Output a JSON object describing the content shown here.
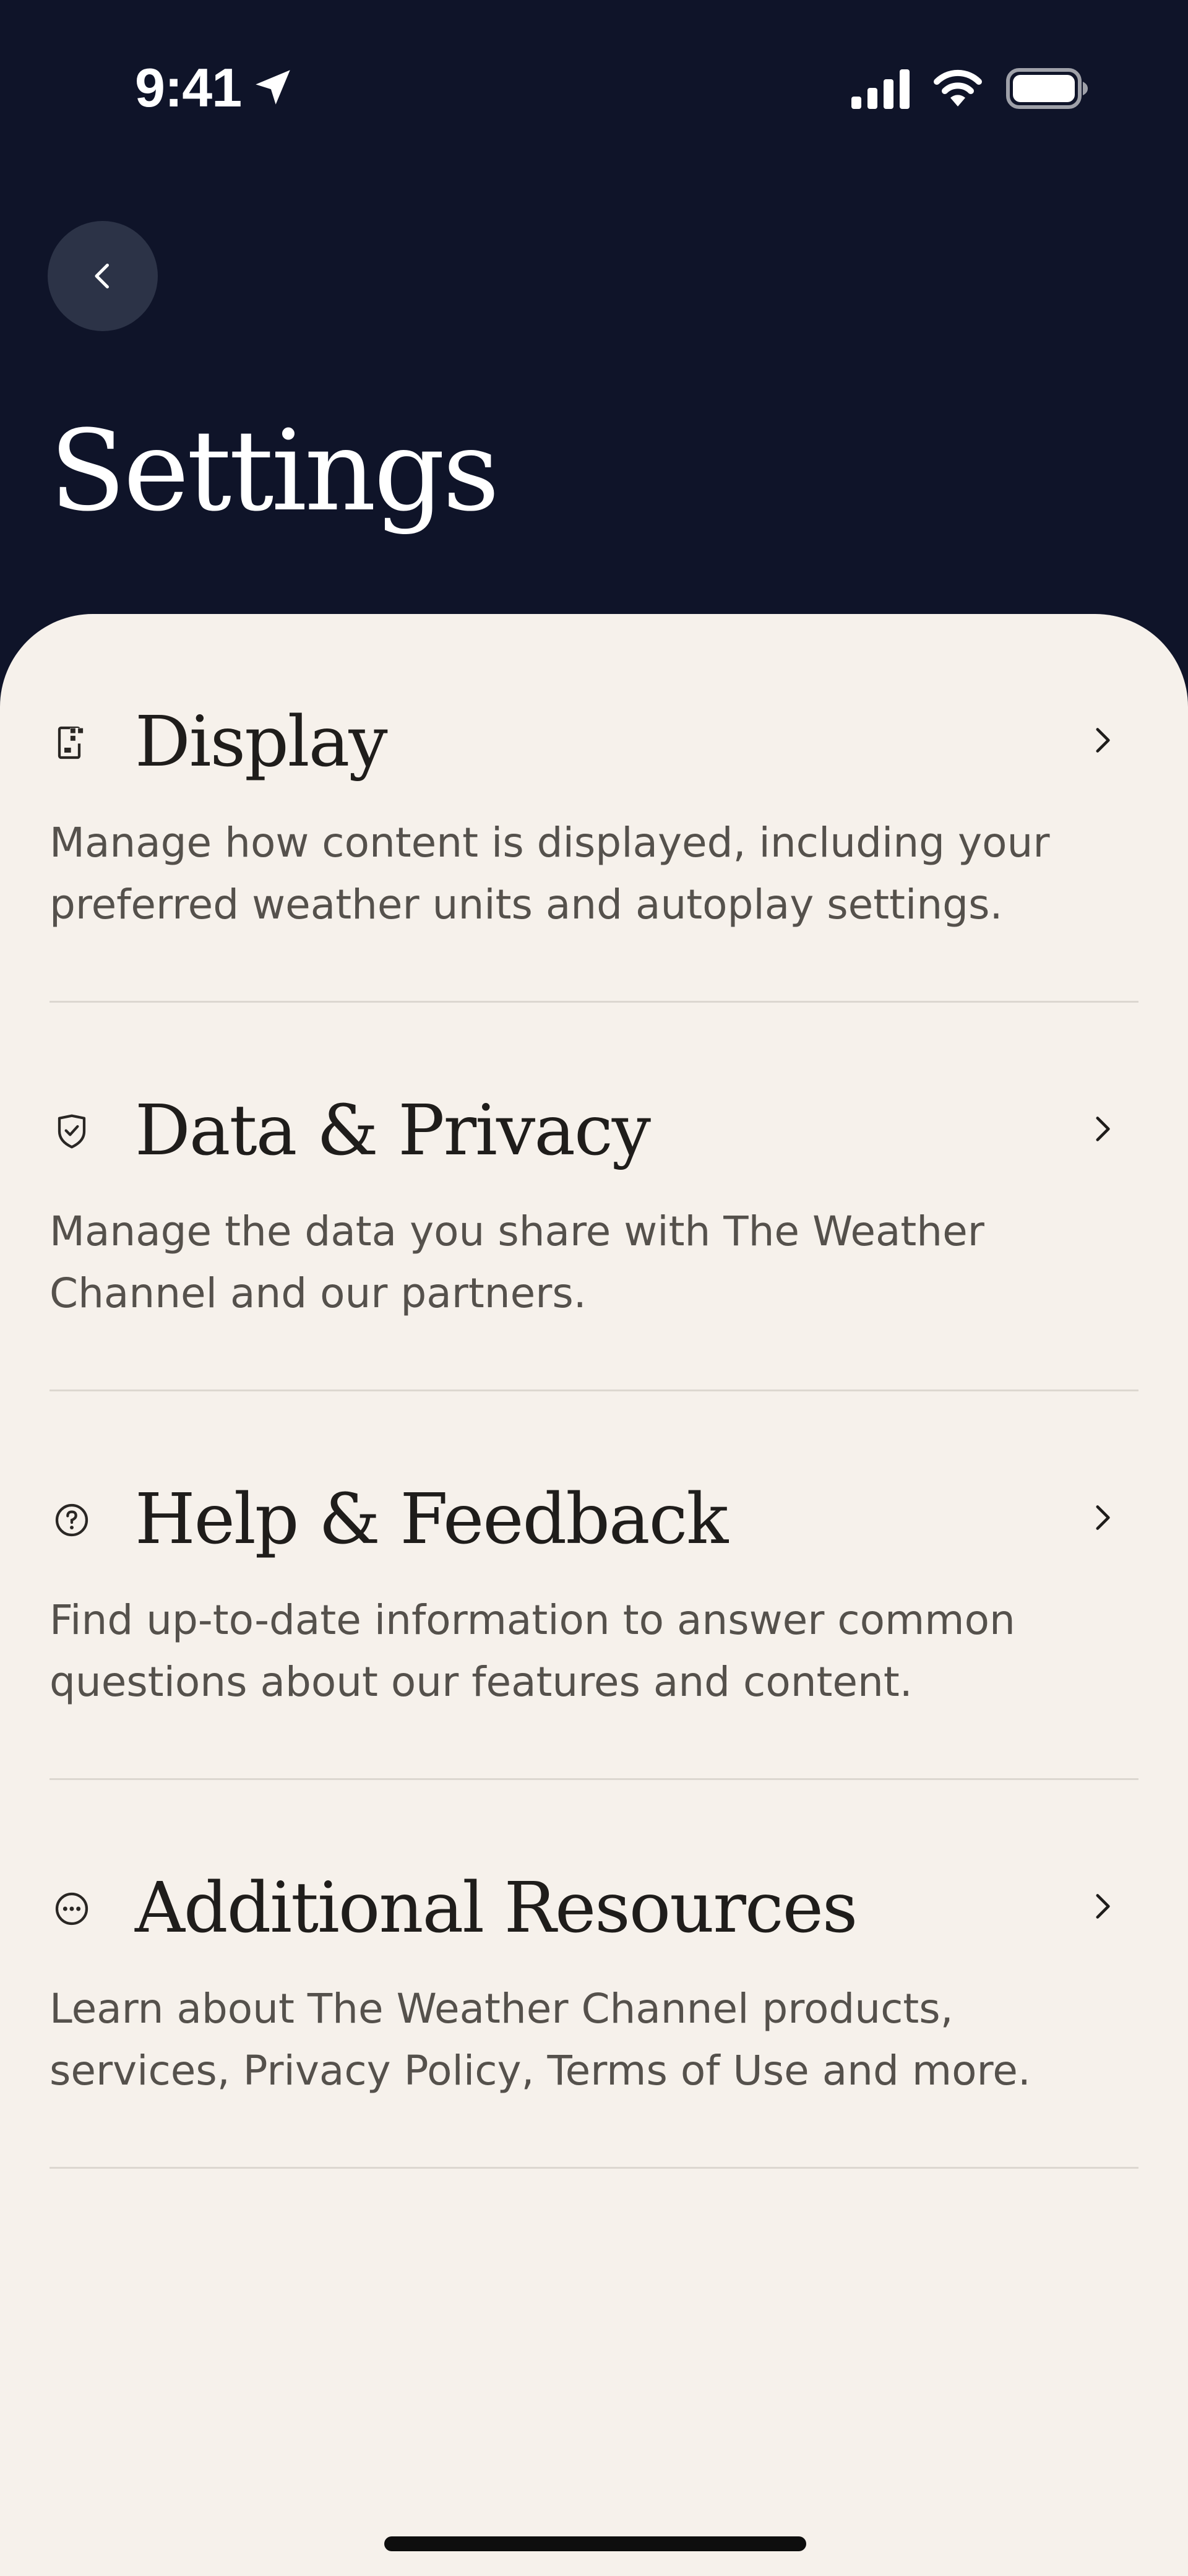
{
  "status_bar": {
    "time": "9:41",
    "icons": [
      "location-arrow-icon",
      "cellular-signal-icon",
      "wifi-icon",
      "battery-icon"
    ]
  },
  "header": {
    "back_icon": "chevron-left-icon",
    "title": "Settings"
  },
  "settings": [
    {
      "icon": "display-icon",
      "title": "Display",
      "description": "Manage how content is displayed, including your preferred weather units and autoplay settings."
    },
    {
      "icon": "shield-check-icon",
      "title": "Data & Privacy",
      "description": "Manage the data you share with The Weather Channel and our partners."
    },
    {
      "icon": "question-circle-icon",
      "title": "Help & Feedback",
      "description": "Find up-to-date information to answer common questions about our features and content."
    },
    {
      "icon": "more-circle-icon",
      "title": "Additional Resources",
      "description": "Learn about The Weather Channel products, services, Privacy Policy, Terms of Use and more."
    }
  ],
  "colors": {
    "header_bg": "#0f1429",
    "sheet_bg": "#f6f1eb",
    "back_button_bg": "#2c3347",
    "divider": "#dcd7d0",
    "title_text": "#1f1d1b",
    "body_text": "#55514c"
  }
}
